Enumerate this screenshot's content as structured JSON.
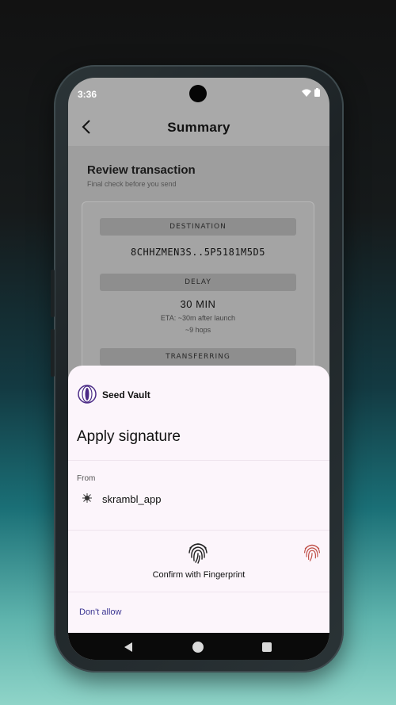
{
  "status_bar": {
    "time": "3:36"
  },
  "header": {
    "title": "Summary"
  },
  "review": {
    "title": "Review transaction",
    "subtitle": "Final check before you send"
  },
  "details": {
    "destination_label": "DESTINATION",
    "destination_value": "8CHHZMEN3S..5P5181M5D5",
    "delay_label": "DELAY",
    "delay_value": "30 MIN",
    "eta": "ETA: ~30m after launch",
    "hops": "~9 hops",
    "transferring_label": "TRANSFERRING"
  },
  "sheet": {
    "vault_name": "Seed Vault",
    "title": "Apply signature",
    "from_label": "From",
    "app_name": "skrambl_app",
    "fingerprint_label": "Confirm with Fingerprint",
    "dont_allow": "Don't allow"
  },
  "icons": {
    "back": "chevron-left-icon",
    "fingerprint": "fingerprint-icon",
    "wifi": "wifi-icon",
    "battery": "battery-icon"
  },
  "colors": {
    "sheet_bg": "#fcf5fb",
    "link": "#3b3592",
    "fingerprint_alt": "#c0524a",
    "vault_purple": "#4b2a86"
  }
}
